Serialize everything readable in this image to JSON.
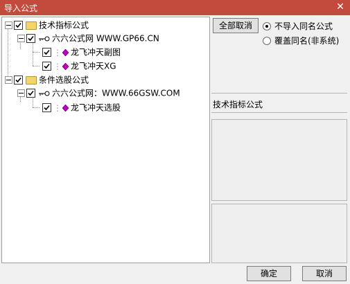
{
  "window": {
    "title": "导入公式",
    "close_glyph": "✕"
  },
  "tree": {
    "group1": {
      "label": "技术指标公式"
    },
    "source1": {
      "label": "六六公式网 WWW.GP66.CN"
    },
    "formula1": {
      "label": "龙飞冲天副图"
    },
    "formula2": {
      "label": "龙飞冲天XG"
    },
    "group2": {
      "label": "条件选股公式"
    },
    "source2": {
      "label": "六六公式网：WWW.66GSW.COM"
    },
    "formula3": {
      "label": "龙飞冲天选股"
    }
  },
  "options": {
    "cancel_all_label": "全部取消",
    "radio_skip_label": "不导入同名公式",
    "radio_overwrite_label": "覆盖同名(非系统)",
    "selected": "skip"
  },
  "info": {
    "section_title": "技术指标公式"
  },
  "footer": {
    "ok_label": "确定",
    "cancel_label": "取消"
  },
  "colors": {
    "title_bar": "#c24b3e",
    "folder": "#f3d66b",
    "gem": "#c000c0"
  }
}
